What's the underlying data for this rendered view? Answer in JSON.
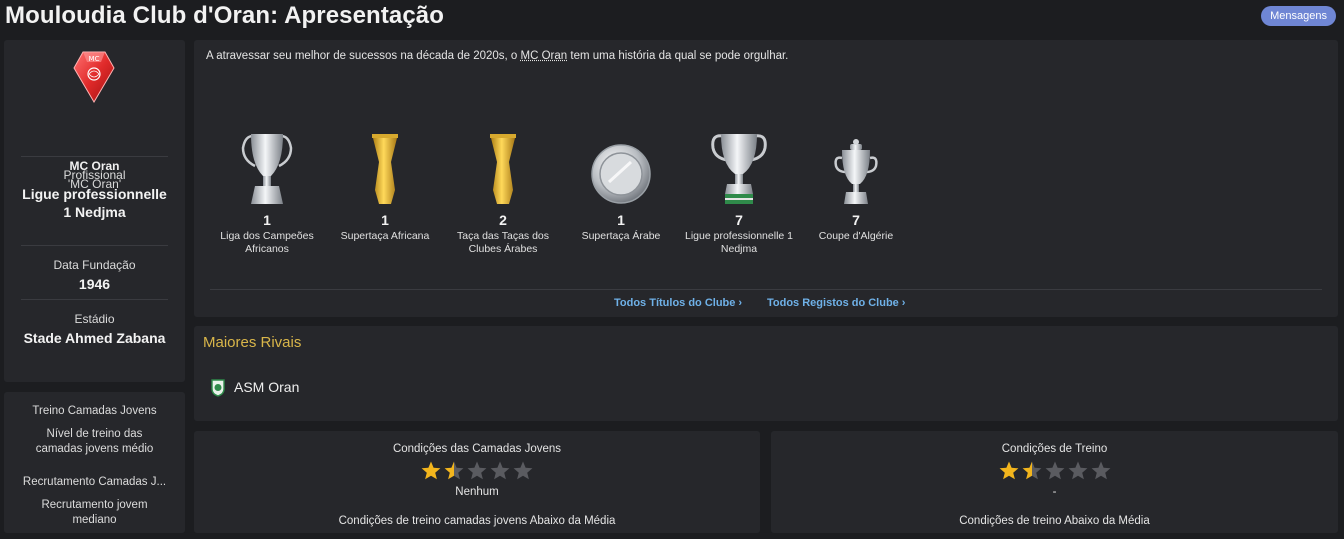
{
  "header": {
    "title": "Mouloudia Club d'Oran: Apresentação",
    "messages_button": "Mensagens"
  },
  "sidebar": {
    "club_name": "MC Oran",
    "club_short": "'MC Oran'",
    "status_label": "Profissional",
    "league_line1": "Ligue professionnelle",
    "league_line2": "1 Nedjma",
    "founded_label": "Data Fundação",
    "founded_value": "1946",
    "stadium_label": "Estádio",
    "stadium_value": "Stade Ahmed Zabana",
    "youth_training_label": "Treino Camadas Jovens",
    "youth_training_value_line1": "Nível de treino das",
    "youth_training_value_line2": "camadas jovens médio",
    "youth_recruit_label": "Recrutamento Camadas J...",
    "youth_recruit_value_line1": "Recrutamento jovem",
    "youth_recruit_value_line2": "mediano"
  },
  "trophies": {
    "intro_prefix": "A atravessar seu melhor de sucessos na década de 2020s, o ",
    "intro_club": "MC Oran",
    "intro_suffix": " tem uma história da qual se pode orgulhar.",
    "items": [
      {
        "count": "1",
        "name_line1": "Liga dos Campeões",
        "name_line2": "Africanos",
        "icon": "silver-cup-icon"
      },
      {
        "count": "1",
        "name_line1": "Supertaça Africana",
        "name_line2": "",
        "icon": "gold-trophy-icon"
      },
      {
        "count": "2",
        "name_line1": "Taça das Taças dos",
        "name_line2": "Clubes Árabes",
        "icon": "gold-trophy-icon"
      },
      {
        "count": "1",
        "name_line1": "Supertaça Árabe",
        "name_line2": "",
        "icon": "silver-plate-icon"
      },
      {
        "count": "7",
        "name_line1": "Ligue professionnelle 1",
        "name_line2": "Nedjma",
        "icon": "silver-cup-green-icon"
      },
      {
        "count": "7",
        "name_line1": "Coupe d'Algérie",
        "name_line2": "",
        "icon": "silver-small-cup-icon"
      }
    ],
    "all_titles_link": "Todos Títulos do Clube",
    "all_records_link": "Todos Registos do Clube"
  },
  "rivals": {
    "title": "Maiores Rivais",
    "items": [
      {
        "name": "ASM Oran"
      }
    ]
  },
  "youth_facilities": {
    "title": "Condições das Camadas Jovens",
    "rating_stars": 1.5,
    "sub": "Nenhum",
    "description": "Condições de treino camadas jovens Abaixo da Média"
  },
  "training_facilities": {
    "title": "Condições de Treino",
    "rating_stars": 1.5,
    "sub": "-",
    "description": "Condições de treino Abaixo da Média"
  },
  "colors": {
    "accent_link": "#6fb1e8",
    "rivals_title": "#d9b64a",
    "star_filled": "#f2b51d",
    "star_empty": "#5a5b60"
  }
}
